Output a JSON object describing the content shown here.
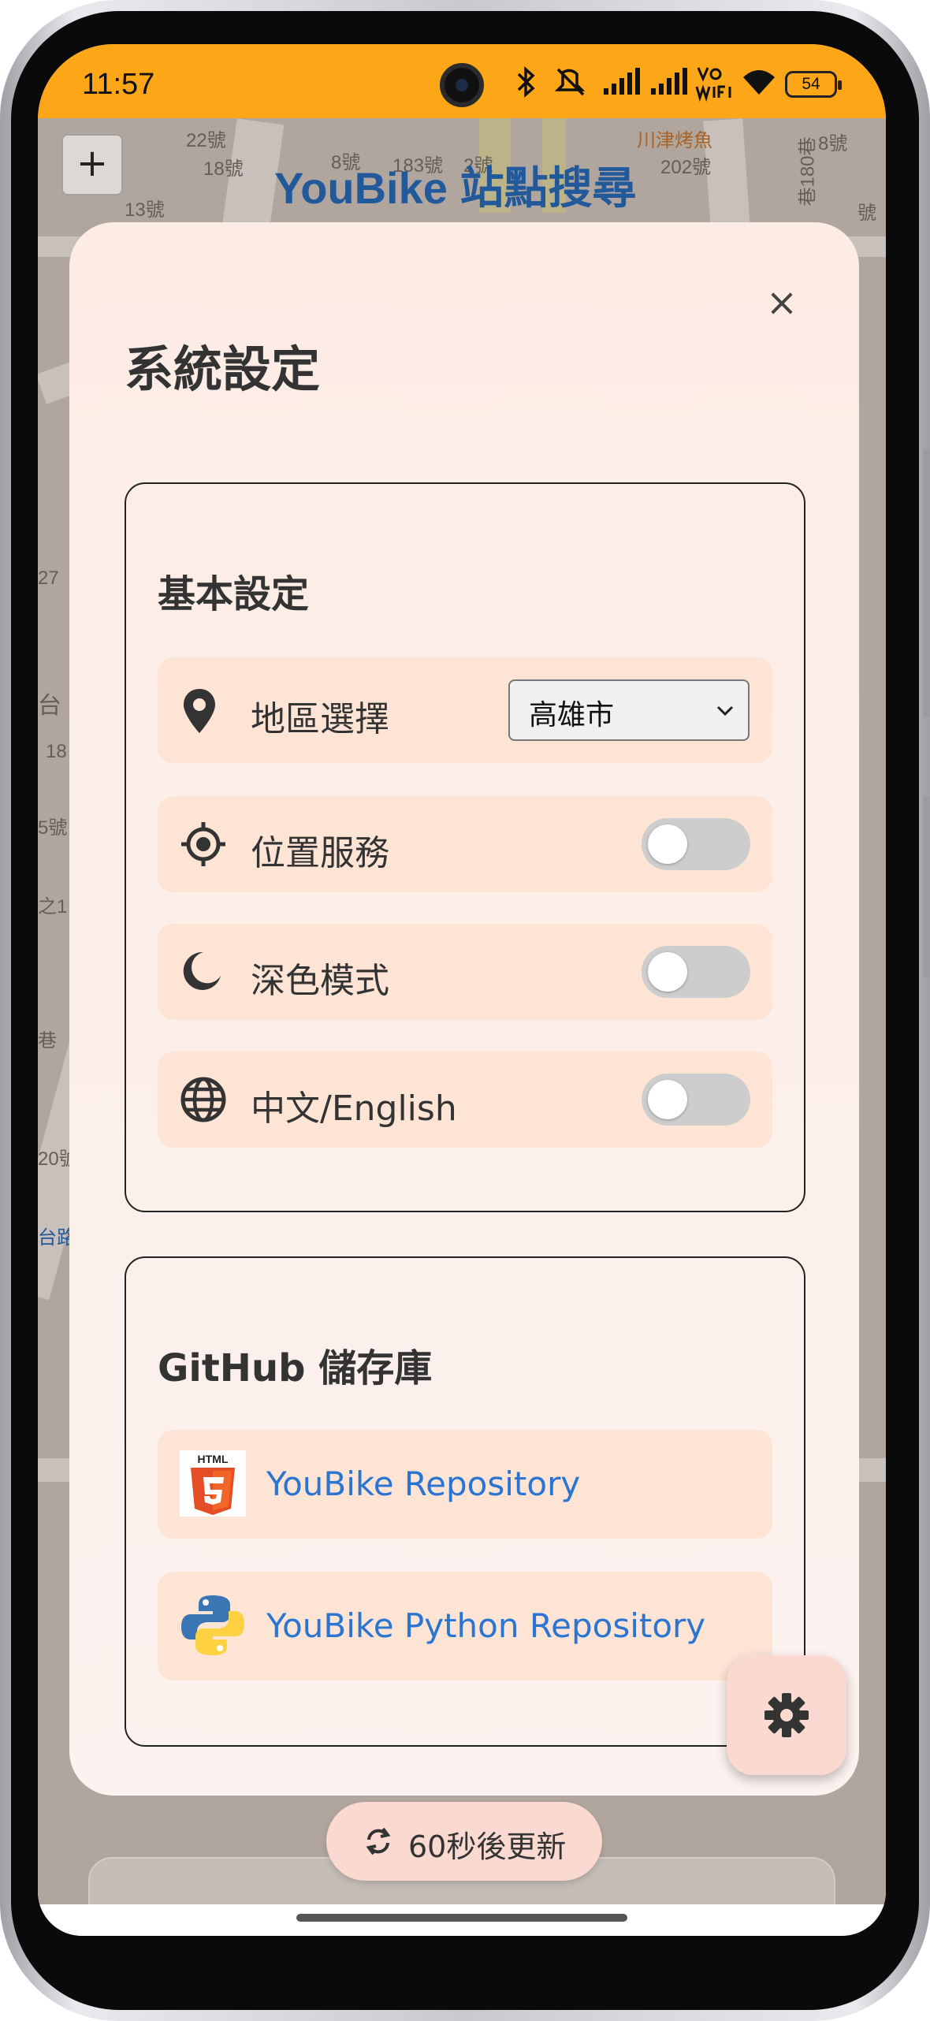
{
  "status_bar": {
    "time": "11:57",
    "battery": "54",
    "background_color": "#fda718",
    "icons": [
      "bluetooth-icon",
      "mute-icon",
      "signal-icon",
      "signal-icon",
      "vowifi-icon",
      "wifi-icon",
      "battery-icon"
    ]
  },
  "map": {
    "title": "YouBike 站點搜尋",
    "zoom_in_label": "+",
    "labels": [
      "22號",
      "18號",
      "8號",
      "183號",
      "2號",
      "13號",
      "202號",
      "8號",
      "號",
      "川津烤魚",
      "巷180巷",
      "27",
      "台",
      "18",
      "5號",
      "之1",
      "20號",
      "台路",
      "巷"
    ]
  },
  "dialog": {
    "title": "系統設定",
    "close_label": "×",
    "background_color": "#fcf0ea",
    "basic_settings": {
      "title": "基本設定",
      "region": {
        "label": "地區選擇",
        "value": "高雄市",
        "icon": "location-pin-icon"
      },
      "location_service": {
        "label": "位置服務",
        "enabled": false,
        "icon": "gps-target-icon"
      },
      "dark_mode": {
        "label": "深色模式",
        "enabled": false,
        "icon": "moon-icon"
      },
      "language": {
        "label": "中文/English",
        "enabled": false,
        "icon": "globe-icon"
      }
    },
    "github": {
      "title": "GitHub 儲存庫",
      "links": [
        {
          "label": "YouBike Repository",
          "icon": "html5-icon"
        },
        {
          "label": "YouBike Python Repository",
          "icon": "python-icon"
        }
      ],
      "link_color": "#2a74d2"
    }
  },
  "settings_fab": {
    "icon": "gear-icon"
  },
  "refresh": {
    "label": "60秒後更新",
    "icon": "refresh-icon"
  }
}
